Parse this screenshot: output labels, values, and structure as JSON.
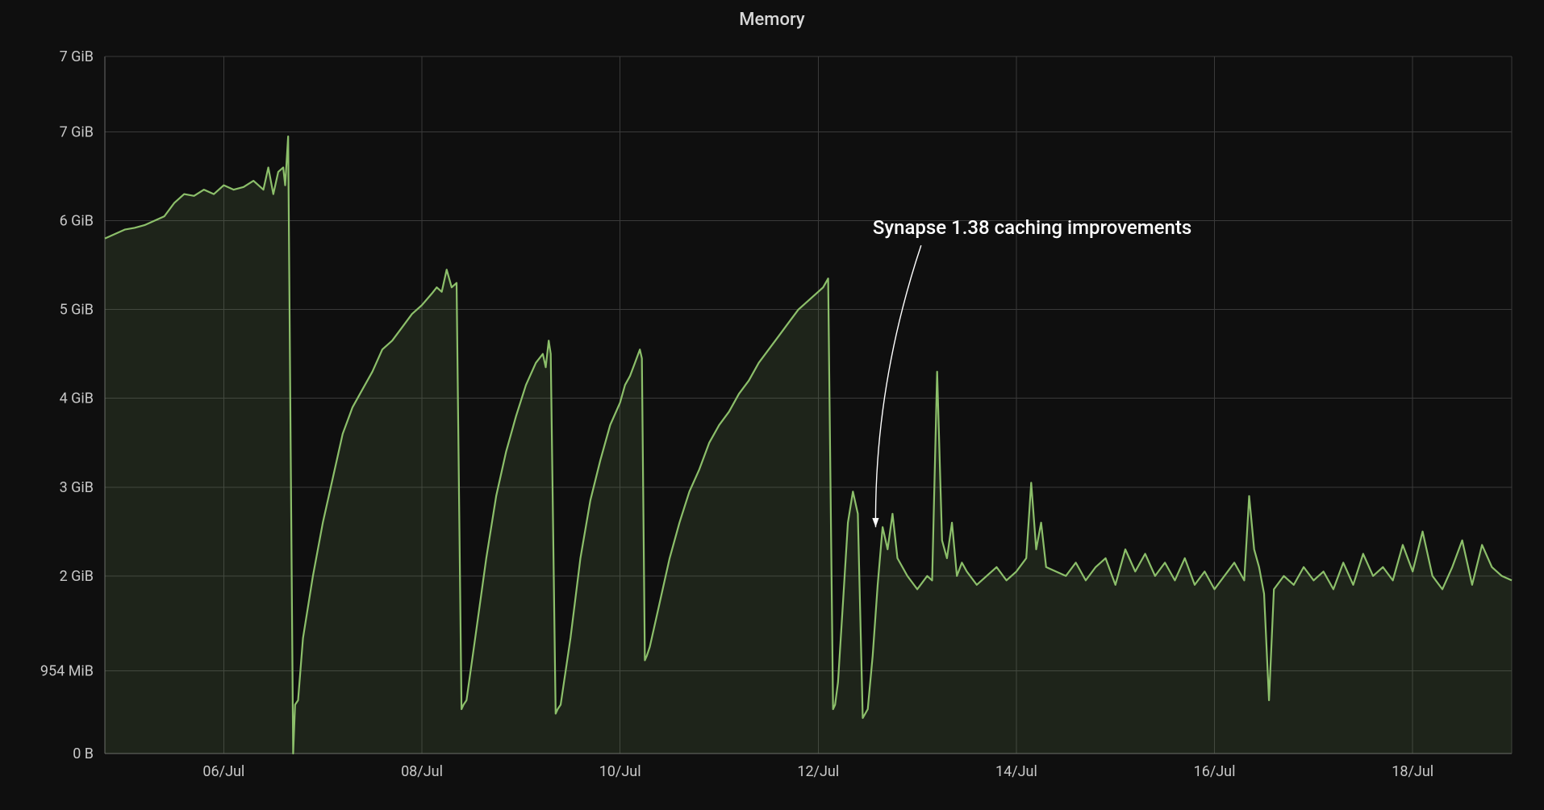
{
  "title": "Memory",
  "annotation": {
    "text": "Synapse 1.38 caching improvements",
    "text_x_day": 12.55,
    "text_y_gib": 5.85,
    "target_x_day": 12.58,
    "target_y_gib": 2.55
  },
  "chart_data": {
    "type": "area",
    "title": "Memory",
    "xlabel": "",
    "ylabel": "",
    "x_axis": {
      "unit": "date (July)",
      "ticks_day": [
        6,
        8,
        10,
        12,
        14,
        16,
        18
      ],
      "tick_labels": [
        "06/Jul",
        "08/Jul",
        "10/Jul",
        "12/Jul",
        "14/Jul",
        "16/Jul",
        "18/Jul"
      ],
      "range_day": [
        4.8,
        19.0
      ]
    },
    "y_axis": {
      "unit": "bytes",
      "ticks_gib": [
        0,
        0.932,
        2,
        3,
        4,
        5,
        6,
        7,
        7.85
      ],
      "tick_labels": [
        "0 B",
        "954 MiB",
        "2 GiB",
        "3 GiB",
        "4 GiB",
        "5 GiB",
        "6 GiB",
        "7 GiB",
        "7 GiB"
      ],
      "range_gib": [
        0,
        7.85
      ]
    },
    "series": [
      {
        "name": "memory",
        "color": "#8cbf6a",
        "x_day": [
          4.8,
          4.9,
          5.0,
          5.1,
          5.2,
          5.3,
          5.4,
          5.5,
          5.6,
          5.7,
          5.8,
          5.9,
          6.0,
          6.1,
          6.2,
          6.3,
          6.4,
          6.45,
          6.5,
          6.55,
          6.6,
          6.62,
          6.65,
          6.7,
          6.72,
          6.75,
          6.8,
          6.9,
          7.0,
          7.1,
          7.2,
          7.3,
          7.4,
          7.5,
          7.6,
          7.7,
          7.8,
          7.9,
          8.0,
          8.1,
          8.15,
          8.2,
          8.25,
          8.3,
          8.35,
          8.4,
          8.42,
          8.45,
          8.55,
          8.65,
          8.75,
          8.85,
          8.95,
          9.05,
          9.15,
          9.22,
          9.25,
          9.28,
          9.3,
          9.35,
          9.37,
          9.4,
          9.5,
          9.6,
          9.7,
          9.8,
          9.9,
          10.0,
          10.05,
          10.1,
          10.15,
          10.2,
          10.22,
          10.25,
          10.27,
          10.3,
          10.4,
          10.5,
          10.6,
          10.7,
          10.8,
          10.9,
          11.0,
          11.1,
          11.2,
          11.3,
          11.4,
          11.5,
          11.6,
          11.7,
          11.8,
          11.9,
          12.0,
          12.05,
          12.1,
          12.15,
          12.17,
          12.2,
          12.25,
          12.3,
          12.35,
          12.4,
          12.45,
          12.5,
          12.55,
          12.6,
          12.65,
          12.7,
          12.75,
          12.8,
          12.9,
          13.0,
          13.1,
          13.15,
          13.2,
          13.25,
          13.3,
          13.35,
          13.4,
          13.45,
          13.5,
          13.6,
          13.7,
          13.8,
          13.9,
          14.0,
          14.1,
          14.15,
          14.2,
          14.25,
          14.3,
          14.4,
          14.5,
          14.6,
          14.7,
          14.8,
          14.9,
          15.0,
          15.1,
          15.2,
          15.3,
          15.4,
          15.5,
          15.6,
          15.7,
          15.8,
          15.9,
          16.0,
          16.1,
          16.2,
          16.3,
          16.35,
          16.4,
          16.45,
          16.5,
          16.55,
          16.6,
          16.7,
          16.8,
          16.9,
          17.0,
          17.1,
          17.2,
          17.3,
          17.4,
          17.5,
          17.6,
          17.7,
          17.8,
          17.9,
          18.0,
          18.1,
          18.2,
          18.3,
          18.4,
          18.5,
          18.6,
          18.7,
          18.8,
          18.9,
          19.0
        ],
        "y_gib": [
          5.8,
          5.85,
          5.9,
          5.92,
          5.95,
          6.0,
          6.05,
          6.2,
          6.3,
          6.28,
          6.35,
          6.3,
          6.4,
          6.35,
          6.38,
          6.45,
          6.35,
          6.6,
          6.3,
          6.55,
          6.6,
          6.4,
          6.95,
          0.0,
          0.55,
          0.6,
          1.3,
          2.0,
          2.6,
          3.1,
          3.6,
          3.9,
          4.1,
          4.3,
          4.55,
          4.65,
          4.8,
          4.95,
          5.05,
          5.18,
          5.25,
          5.2,
          5.45,
          5.25,
          5.3,
          0.5,
          0.55,
          0.6,
          1.4,
          2.2,
          2.9,
          3.4,
          3.8,
          4.15,
          4.4,
          4.5,
          4.35,
          4.65,
          4.5,
          0.45,
          0.5,
          0.55,
          1.3,
          2.2,
          2.85,
          3.3,
          3.7,
          3.95,
          4.15,
          4.25,
          4.4,
          4.55,
          4.45,
          1.05,
          1.1,
          1.2,
          1.7,
          2.2,
          2.6,
          2.95,
          3.2,
          3.5,
          3.7,
          3.85,
          4.05,
          4.2,
          4.4,
          4.55,
          4.7,
          4.85,
          5.0,
          5.1,
          5.2,
          5.25,
          5.35,
          0.5,
          0.55,
          0.8,
          1.7,
          2.6,
          2.95,
          2.7,
          0.4,
          0.5,
          1.1,
          1.9,
          2.55,
          2.3,
          2.7,
          2.2,
          2.0,
          1.85,
          2.0,
          1.95,
          4.3,
          2.4,
          2.2,
          2.6,
          2.0,
          2.15,
          2.05,
          1.9,
          2.0,
          2.1,
          1.95,
          2.05,
          2.2,
          3.05,
          2.3,
          2.6,
          2.1,
          2.05,
          2.0,
          2.15,
          1.95,
          2.1,
          2.2,
          1.9,
          2.3,
          2.05,
          2.25,
          2.0,
          2.15,
          1.95,
          2.2,
          1.9,
          2.05,
          1.85,
          2.0,
          2.15,
          1.95,
          2.9,
          2.3,
          2.1,
          1.8,
          0.6,
          1.85,
          2.0,
          1.9,
          2.1,
          1.95,
          2.05,
          1.85,
          2.15,
          1.9,
          2.25,
          2.0,
          2.1,
          1.95,
          2.35,
          2.05,
          2.5,
          2.0,
          1.85,
          2.1,
          2.4,
          1.9,
          2.35,
          2.1,
          2.0,
          1.95
        ]
      }
    ]
  }
}
